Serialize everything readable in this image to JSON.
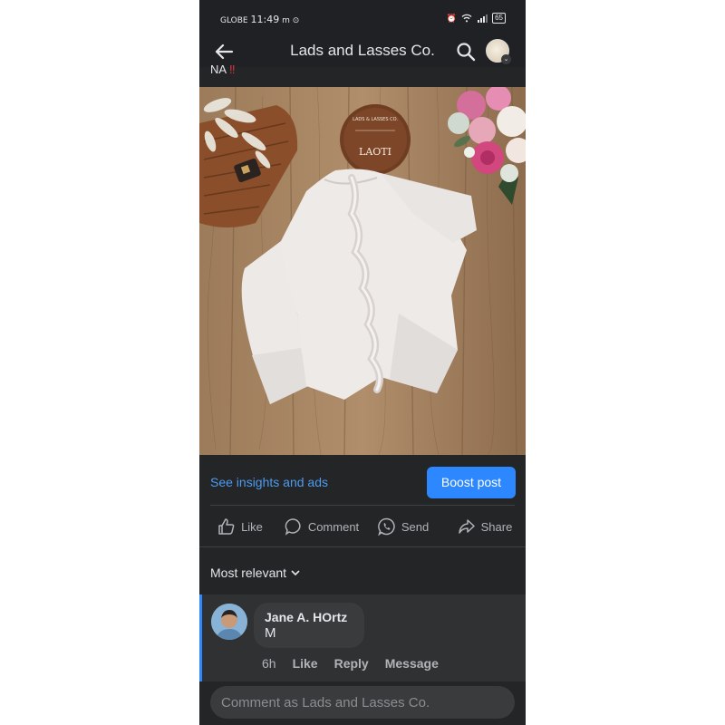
{
  "status_bar": {
    "carrier": "GLOBE",
    "time": "11:49",
    "battery": "65"
  },
  "header": {
    "title": "Lads and Lasses Co."
  },
  "post": {
    "caption_fragment": "NA",
    "caption_emoji": "‼",
    "product_sign_text": "LADS & LASSES CO.",
    "product_sign_name": "LAOTI"
  },
  "post_footer": {
    "insights_link": "See insights and ads",
    "boost_button": "Boost post"
  },
  "actions": {
    "like": "Like",
    "comment": "Comment",
    "send": "Send",
    "share": "Share"
  },
  "comments": {
    "sort_label": "Most relevant",
    "items": [
      {
        "author": "Jane A. HOrtz",
        "text": "M",
        "time": "6h",
        "like": "Like",
        "reply": "Reply",
        "message": "Message"
      }
    ]
  },
  "composer": {
    "placeholder": "Comment as Lads and Lasses Co."
  },
  "colors": {
    "background": "#242526",
    "accent": "#2d88ff",
    "link": "#4d9bf0"
  }
}
